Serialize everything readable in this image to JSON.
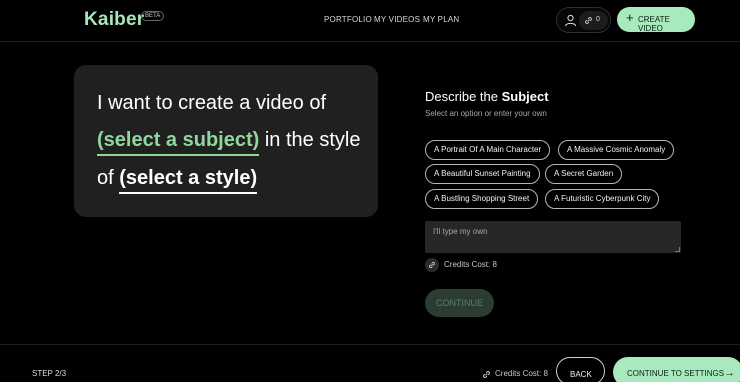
{
  "header": {
    "logo": "Kaiber",
    "badge": "BETA",
    "nav": [
      "PORTFOLIO",
      "MY VIDEOS",
      "MY PLAN"
    ],
    "credits": "0",
    "create_label": "CREATE VIDEO",
    "create_icon": "+"
  },
  "prompt": {
    "line1": "I want to create a video of",
    "subject_placeholder": "(select a subject)",
    "mid": " in the style",
    "of": "of ",
    "style_placeholder": "(select a style)"
  },
  "subject": {
    "title_prefix": "Describe the ",
    "title_bold": "Subject",
    "subtitle": "Select an option or enter your own",
    "options": [
      "A Portrait Of A Main Character",
      "A Massive Cosmic Anomaly",
      "A Beautiful Sunset Painting",
      "A Secret Garden",
      "A Bustling Shopping Street",
      "A Futuristic Cyberpunk City"
    ],
    "input_placeholder": "I'll type my own",
    "credits_cost": "Credits Cost: 8",
    "continue_label": "CONTINUE"
  },
  "footer": {
    "step": "STEP 2/3",
    "credits_cost": "Credits Cost: 8",
    "back_label": "BACK",
    "settings_label": "CONTINUE TO SETTINGS",
    "settings_arrow": "→"
  },
  "colors": {
    "accent": "#a8e9bd",
    "subject_highlight": "#8fd89d",
    "card_bg": "#202020",
    "page_bg": "#000000"
  }
}
